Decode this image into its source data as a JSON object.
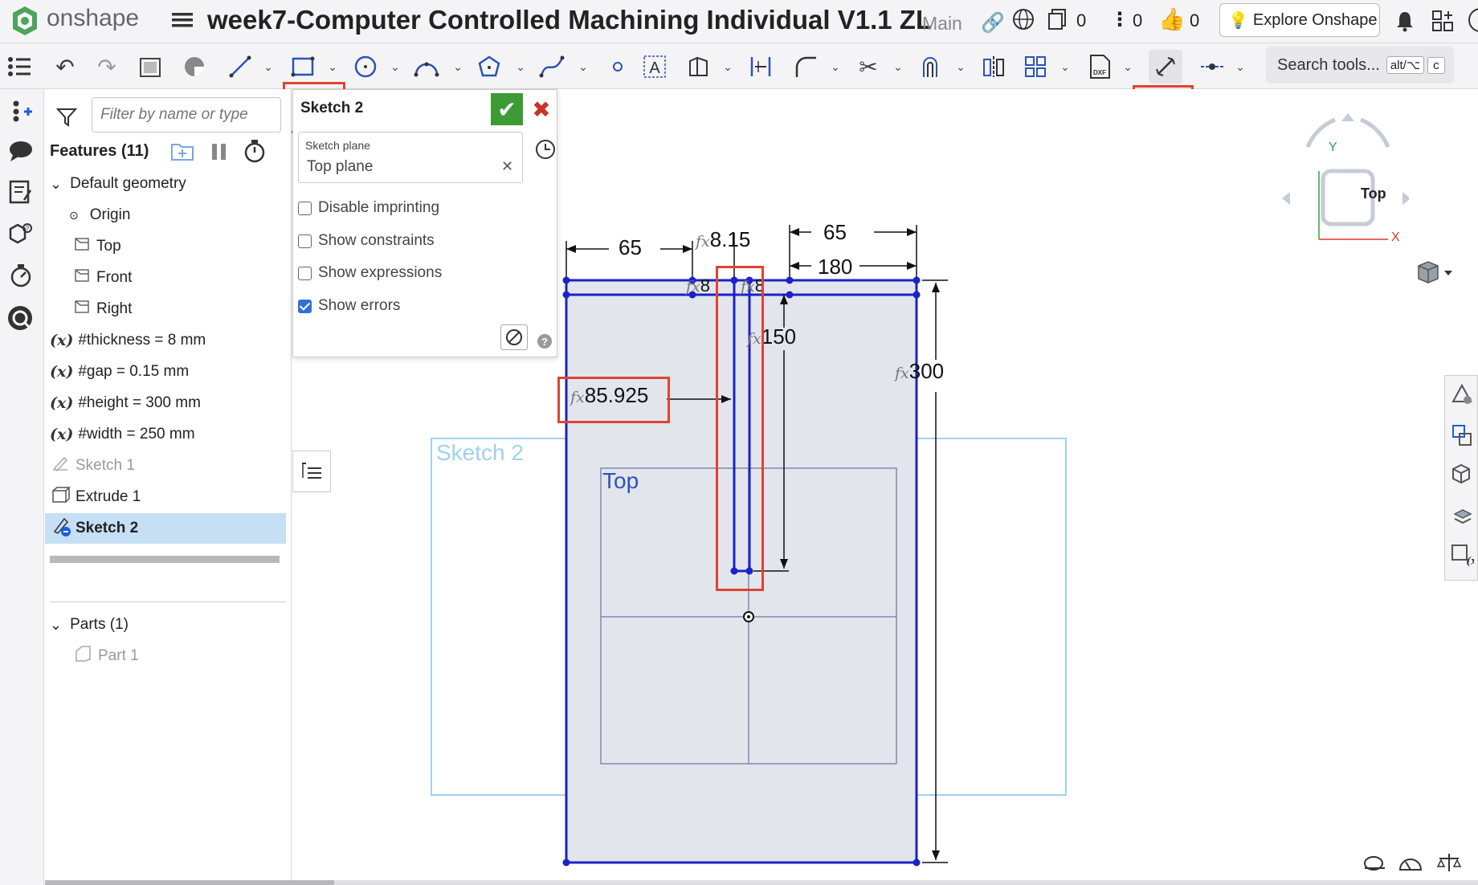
{
  "header": {
    "brand": "onshape",
    "doc_title": "week7-Computer Controlled Machining Individual V1.1 ZL",
    "branch": "Main",
    "versions_count": "0",
    "info_count": "0",
    "likes_count": "0",
    "explore_label": "Explore Onshape"
  },
  "toolbar": {
    "search_label": "Search tools...",
    "search_shortcut_1": "alt/⌥",
    "search_shortcut_2": "c"
  },
  "feature_panel": {
    "filter_placeholder": "Filter by name or type",
    "features_title": "Features (11)",
    "default_geometry": "Default geometry",
    "items": [
      {
        "label": "Origin"
      },
      {
        "label": "Top"
      },
      {
        "label": "Front"
      },
      {
        "label": "Right"
      }
    ],
    "variables": [
      {
        "prefix": "(x)",
        "label": "#thickness = 8 mm"
      },
      {
        "prefix": "(x)",
        "label": "#gap = 0.15 mm"
      },
      {
        "prefix": "(x)",
        "label": "#height = 300 mm"
      },
      {
        "prefix": "(x)",
        "label": "#width = 250 mm"
      }
    ],
    "sketch1": "Sketch 1",
    "extrude1": "Extrude 1",
    "sketch2": "Sketch 2",
    "parts_title": "Parts (1)",
    "part1": "Part 1"
  },
  "sketch_dialog": {
    "title": "Sketch 2",
    "plane_label": "Sketch plane",
    "plane_value": "Top plane",
    "options": [
      {
        "label": "Disable imprinting",
        "checked": false
      },
      {
        "label": "Show constraints",
        "checked": false
      },
      {
        "label": "Show expressions",
        "checked": false
      },
      {
        "label": "Show errors",
        "checked": true
      }
    ]
  },
  "viewport": {
    "sketch_label": "Sketch 2",
    "plane_label": "Top",
    "dims": {
      "d65_left": "65",
      "d815": "8.15",
      "d65_right": "65",
      "d180": "180",
      "d8_left": "8",
      "d8_right": "8",
      "d150": "150",
      "d300": "300",
      "d85925": "85.925"
    },
    "viewcube": {
      "face": "Top",
      "axis_x": "X",
      "axis_y": "Y"
    }
  },
  "colors": {
    "accent_blue": "#1a22c8",
    "highlight_red": "#e0432f",
    "selected_row": "#c5dff5",
    "confirm_green": "#3d9b35"
  }
}
